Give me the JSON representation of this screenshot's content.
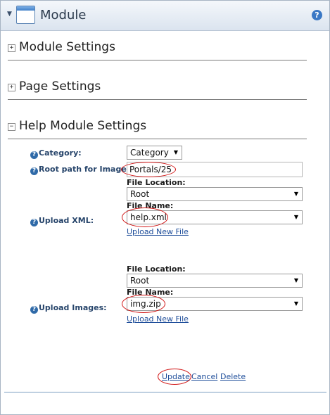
{
  "window": {
    "title": "Module",
    "help": "?"
  },
  "sections": [
    {
      "label": "Module Settings",
      "toggle": "+"
    },
    {
      "label": "Page Settings",
      "toggle": "+"
    },
    {
      "label": "Help Module Settings",
      "toggle": "−"
    }
  ],
  "form": {
    "category": {
      "label": "Category:",
      "value": "Category"
    },
    "root_path": {
      "label": "Root path for Images:",
      "value": "Portals/25"
    },
    "upload_xml": {
      "label": "Upload XML:",
      "file_location_label": "File Location:",
      "file_location_value": "Root",
      "file_name_label": "File Name:",
      "file_name_value": "help.xml",
      "upload_link": "Upload New File"
    },
    "upload_images": {
      "label": "Upload Images:",
      "file_location_label": "File Location:",
      "file_location_value": "Root",
      "file_name_label": "File Name:",
      "file_name_value": "img.zip",
      "upload_link": "Upload New File"
    }
  },
  "actions": {
    "update": "Update",
    "cancel": "Cancel",
    "delete": "Delete"
  },
  "colors": {
    "accent": "#27456b",
    "link": "#1f4e9a",
    "highlight": "#d01010"
  }
}
